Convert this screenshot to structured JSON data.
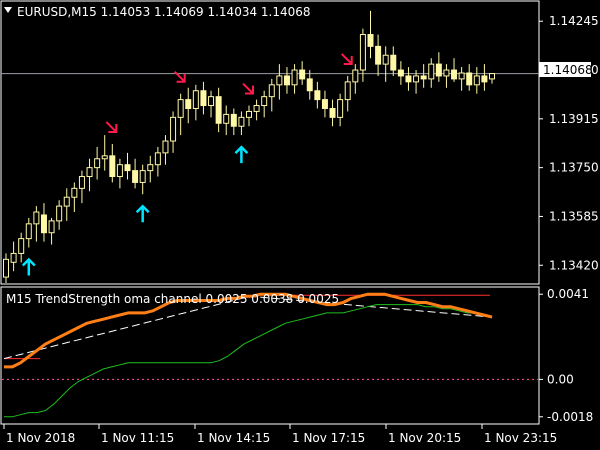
{
  "main_chart": {
    "symbol_label": "EURUSD,M15  1.14053 1.14069 1.14034 1.14068",
    "current_price_tag": "1.14068",
    "y_axis_labels": [
      "1.14245",
      "1.14080",
      "1.13915",
      "1.13750",
      "1.13585",
      "1.13420"
    ]
  },
  "indicator": {
    "label": "M15 TrendStrength oma channel 0.0025 0.0038 0.0025",
    "y_axis_labels": [
      "0.0041",
      "0.00",
      "-0.0018"
    ]
  },
  "x_axis_labels": [
    "1 Nov 2018",
    "1 Nov 11:15",
    "1 Nov 14:15",
    "1 Nov 17:15",
    "1 Nov 20:15",
    "1 Nov 23:15"
  ],
  "colors": {
    "candle": "#fff8a6",
    "axis": "#ffffff",
    "up_arrow": "#00e5ff",
    "down_arrow": "#ff1a4a",
    "orange_line": "#ff7f17",
    "green_line": "#1fbf1f",
    "red_level": "#ff2d2d",
    "dashed_line": "#ffffff",
    "zero_line": "#ff4fa0"
  },
  "chart_data": [
    {
      "type": "candlestick",
      "title": "EURUSD,M15",
      "ylim": [
        1.1336,
        1.1431
      ],
      "ticks": [
        1.14245,
        1.1408,
        1.13915,
        1.1375,
        1.13585,
        1.1342
      ],
      "current_price": 1.14068,
      "ohlc": [
        [
          1.1338,
          1.1346,
          1.1336,
          1.1344
        ],
        [
          1.1343,
          1.135,
          1.134,
          1.1346
        ],
        [
          1.1346,
          1.1353,
          1.1343,
          1.1351
        ],
        [
          1.1351,
          1.1358,
          1.1348,
          1.1356
        ],
        [
          1.1356,
          1.1362,
          1.135,
          1.136
        ],
        [
          1.1359,
          1.1363,
          1.135,
          1.1353
        ],
        [
          1.1353,
          1.1358,
          1.1349,
          1.1357
        ],
        [
          1.1357,
          1.1364,
          1.1354,
          1.1362
        ],
        [
          1.1362,
          1.1368,
          1.1357,
          1.1365
        ],
        [
          1.1365,
          1.137,
          1.136,
          1.1368
        ],
        [
          1.1368,
          1.1374,
          1.1363,
          1.1372
        ],
        [
          1.1372,
          1.1378,
          1.1367,
          1.1375
        ],
        [
          1.1375,
          1.1382,
          1.1371,
          1.1378
        ],
        [
          1.1378,
          1.1386,
          1.1374,
          1.1379
        ],
        [
          1.1379,
          1.1383,
          1.137,
          1.1372
        ],
        [
          1.1372,
          1.1378,
          1.1368,
          1.1376
        ],
        [
          1.1376,
          1.138,
          1.1371,
          1.1374
        ],
        [
          1.1374,
          1.1378,
          1.1368,
          1.137
        ],
        [
          1.137,
          1.1376,
          1.1366,
          1.1374
        ],
        [
          1.1374,
          1.1379,
          1.137,
          1.1376
        ],
        [
          1.1376,
          1.1382,
          1.1372,
          1.138
        ],
        [
          1.138,
          1.1386,
          1.1376,
          1.1384
        ],
        [
          1.1384,
          1.1394,
          1.138,
          1.1392
        ],
        [
          1.1392,
          1.14,
          1.1386,
          1.1398
        ],
        [
          1.1398,
          1.1402,
          1.139,
          1.1395
        ],
        [
          1.1395,
          1.1403,
          1.1391,
          1.1401
        ],
        [
          1.1401,
          1.1404,
          1.1393,
          1.1396
        ],
        [
          1.1396,
          1.1401,
          1.1392,
          1.1399
        ],
        [
          1.1399,
          1.1402,
          1.1387,
          1.139
        ],
        [
          1.139,
          1.1396,
          1.1386,
          1.1393
        ],
        [
          1.1393,
          1.1395,
          1.1386,
          1.1389
        ],
        [
          1.1389,
          1.1394,
          1.1386,
          1.1392
        ],
        [
          1.1392,
          1.1396,
          1.1389,
          1.1394
        ],
        [
          1.1394,
          1.1398,
          1.1391,
          1.1396
        ],
        [
          1.1396,
          1.1401,
          1.1392,
          1.1399
        ],
        [
          1.1399,
          1.1405,
          1.1394,
          1.1403
        ],
        [
          1.1403,
          1.141,
          1.1398,
          1.1406
        ],
        [
          1.1406,
          1.1409,
          1.14,
          1.1403
        ],
        [
          1.1403,
          1.141,
          1.14,
          1.1408
        ],
        [
          1.1408,
          1.1411,
          1.1403,
          1.1405
        ],
        [
          1.1405,
          1.1408,
          1.1398,
          1.1401
        ],
        [
          1.1401,
          1.1404,
          1.1395,
          1.1398
        ],
        [
          1.1398,
          1.1401,
          1.1392,
          1.1395
        ],
        [
          1.1395,
          1.1398,
          1.1389,
          1.1392
        ],
        [
          1.1392,
          1.14,
          1.1389,
          1.1398
        ],
        [
          1.1398,
          1.1406,
          1.1394,
          1.1404
        ],
        [
          1.1404,
          1.141,
          1.14,
          1.1408
        ],
        [
          1.1408,
          1.1422,
          1.1404,
          1.142
        ],
        [
          1.142,
          1.1428,
          1.1412,
          1.1416
        ],
        [
          1.1416,
          1.142,
          1.1406,
          1.141
        ],
        [
          1.141,
          1.1416,
          1.1404,
          1.1413
        ],
        [
          1.1413,
          1.1416,
          1.1406,
          1.1408
        ],
        [
          1.1408,
          1.1411,
          1.1403,
          1.1406
        ],
        [
          1.1406,
          1.1409,
          1.1401,
          1.1404
        ],
        [
          1.1404,
          1.1408,
          1.14,
          1.1406
        ],
        [
          1.1406,
          1.141,
          1.1402,
          1.1405
        ],
        [
          1.1405,
          1.1412,
          1.1402,
          1.141
        ],
        [
          1.141,
          1.1414,
          1.1404,
          1.1406
        ],
        [
          1.1406,
          1.141,
          1.1402,
          1.1408
        ],
        [
          1.1408,
          1.1412,
          1.1404,
          1.1405
        ],
        [
          1.1405,
          1.1409,
          1.1401,
          1.1407
        ],
        [
          1.1407,
          1.141,
          1.1401,
          1.1403
        ],
        [
          1.1403,
          1.1409,
          1.14,
          1.1406
        ],
        [
          1.1406,
          1.141,
          1.1401,
          1.1404
        ],
        [
          1.1405,
          1.14069,
          1.14034,
          1.14068
        ]
      ],
      "up_arrows_at": [
        3,
        18,
        31
      ],
      "down_arrows_at": [
        14,
        23,
        32,
        45
      ]
    },
    {
      "type": "line",
      "title": "M15 TrendStrength oma channel 0.0025 0.0038 0.0025",
      "ylim": [
        -0.0021,
        0.0044
      ],
      "ticks": [
        0.0041,
        0.0,
        -0.0018
      ],
      "series": [
        {
          "values": [
            0.0006,
            0.0006,
            0.0008,
            0.0011,
            0.0014,
            0.0017,
            0.0019,
            0.0021,
            0.0023,
            0.0025,
            0.0027,
            0.0028,
            0.0029,
            0.003,
            0.0031,
            0.0032,
            0.0032,
            0.0032,
            0.0033,
            0.0035,
            0.0037,
            0.0038,
            0.0038,
            0.0038,
            0.0038,
            0.0038,
            0.0038,
            0.0039,
            0.0039,
            0.004,
            0.004,
            0.0041,
            0.0041,
            0.0041,
            0.0041,
            0.004,
            0.0039,
            0.0038,
            0.0037,
            0.0036,
            0.0036,
            0.0037,
            0.0039,
            0.004,
            0.0041,
            0.0041,
            0.0041,
            0.004,
            0.0039,
            0.0038,
            0.0037,
            0.0037,
            0.0036,
            0.0035,
            0.0035,
            0.0034,
            0.0033,
            0.0032,
            0.0031,
            0.003
          ]
        },
        {
          "values": [
            -0.0018,
            -0.0018,
            -0.0017,
            -0.0016,
            -0.0016,
            -0.0015,
            -0.0012,
            -0.0008,
            -0.0004,
            -0.0001,
            0.0001,
            0.0003,
            0.0005,
            0.0006,
            0.0007,
            0.0008,
            0.0008,
            0.0008,
            0.0008,
            0.0008,
            0.0008,
            0.0008,
            0.0008,
            0.0008,
            0.0008,
            0.0008,
            0.0009,
            0.0011,
            0.0014,
            0.0017,
            0.0019,
            0.0021,
            0.0023,
            0.0025,
            0.0027,
            0.0028,
            0.0029,
            0.003,
            0.0031,
            0.0032,
            0.0032,
            0.0032,
            0.0033,
            0.0034,
            0.0035,
            0.0036,
            0.0036,
            0.0036,
            0.0036,
            0.0036,
            0.0036,
            0.0035,
            0.0035,
            0.0034,
            0.0034,
            0.0033,
            0.0032,
            0.0032,
            0.0031,
            0.003
          ]
        },
        {
          "values": [
            0.001,
            0.004
          ]
        },
        {
          "values": [
            0.001,
            0.0024,
            0.004,
            0.003
          ]
        }
      ]
    }
  ]
}
